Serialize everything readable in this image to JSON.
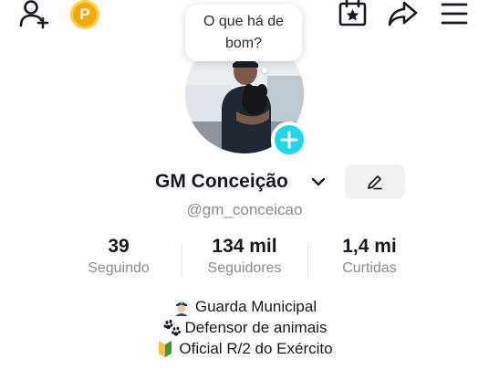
{
  "header": {
    "coin_label": "P",
    "icons": [
      "add-user-icon",
      "coin-icon",
      "calendar-star-icon",
      "share-icon",
      "menu-icon"
    ]
  },
  "bubble": {
    "line1": "O que há de",
    "line2": "bom?"
  },
  "profile": {
    "name": "GM Conceição",
    "handle": "@gm_conceicao"
  },
  "stats": [
    {
      "value": "39",
      "label": "Seguindo"
    },
    {
      "value": "134 mil",
      "label": "Seguidores"
    },
    {
      "value": "1,4 mi",
      "label": "Curtidas"
    }
  ],
  "bio": [
    {
      "emoji": "police-officer-icon",
      "text": "Guarda Municipal"
    },
    {
      "emoji": "paw-prints-icon",
      "text": "Defensor de animais"
    },
    {
      "emoji": "beginner-symbol-icon",
      "text": "Oficial R/2 do Exército"
    }
  ],
  "colors": {
    "accent": "#20d5ec",
    "coin": "#f4a90b",
    "text": "#161823",
    "muted": "#8a8b91"
  }
}
